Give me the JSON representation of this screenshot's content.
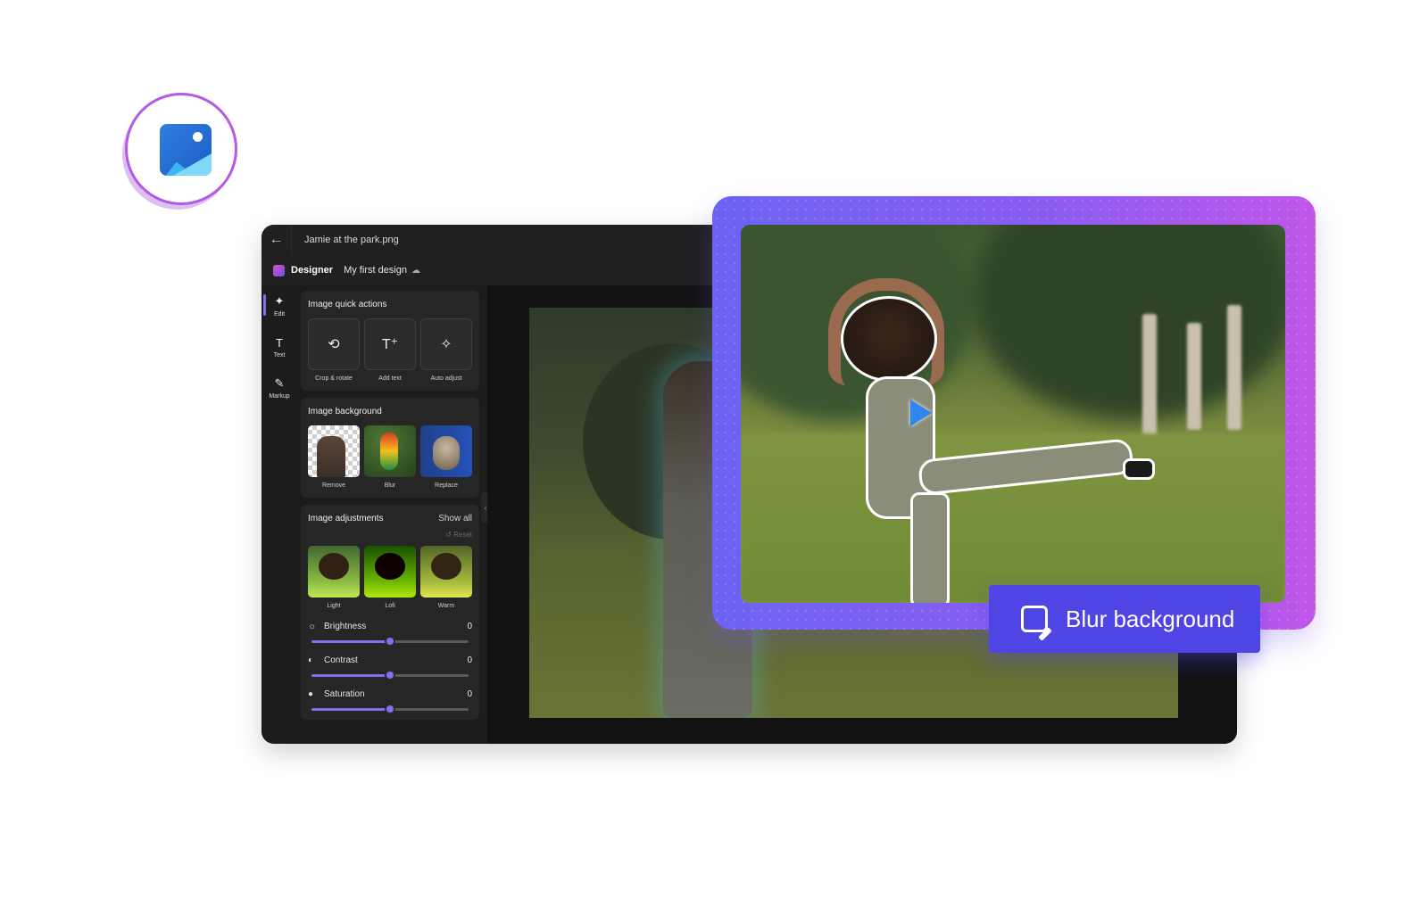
{
  "window": {
    "file_title": "Jamie at the park.png",
    "back_icon": "arrow-left-icon",
    "app_name": "Designer",
    "design_name": "My first design",
    "sync_icon": "cloud-sync-icon"
  },
  "rail": [
    {
      "label": "Edit",
      "icon": "sparkle-icon"
    },
    {
      "label": "Text",
      "icon": "text-icon"
    },
    {
      "label": "Markup",
      "icon": "pen-icon"
    }
  ],
  "quick_actions": {
    "title": "Image quick actions",
    "items": [
      {
        "label": "Crop & rotate",
        "icon": "crop-rotate-icon"
      },
      {
        "label": "Add text",
        "icon": "add-text-icon"
      },
      {
        "label": "Auto adjust",
        "icon": "magic-wand-icon"
      }
    ]
  },
  "background": {
    "title": "Image background",
    "items": [
      {
        "label": "Remove"
      },
      {
        "label": "Blur"
      },
      {
        "label": "Replace"
      }
    ]
  },
  "adjustments": {
    "title": "Image adjustments",
    "show_all": "Show all",
    "reset": "Reset",
    "filters": [
      {
        "label": "Light"
      },
      {
        "label": "Lofi"
      },
      {
        "label": "Warm"
      }
    ],
    "sliders": [
      {
        "label": "Brightness",
        "value": "0",
        "level": 0.5
      },
      {
        "label": "Contrast",
        "value": "0",
        "level": 0.5
      },
      {
        "label": "Saturation",
        "value": "0",
        "level": 0.5
      }
    ]
  },
  "blur_button": {
    "label": "Blur background",
    "icon": "image-blur-icon"
  },
  "colors": {
    "accent": "#8a6cf0",
    "button": "#4e45e4",
    "frame_start": "#6c63f2",
    "frame_end": "#c056ea"
  }
}
